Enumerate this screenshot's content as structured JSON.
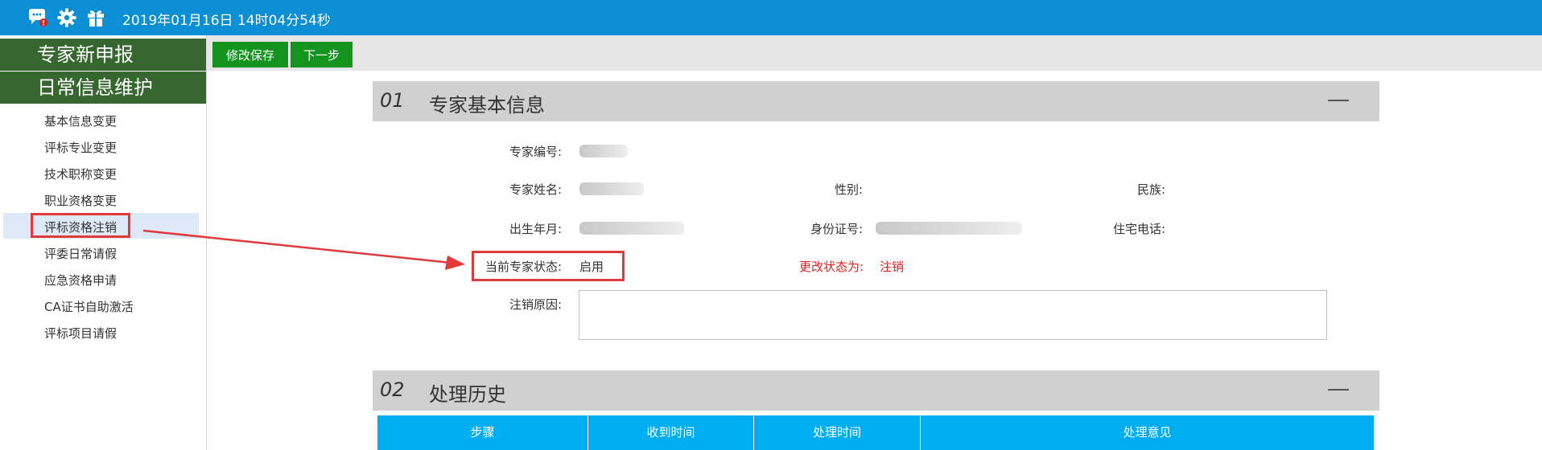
{
  "header": {
    "datetime": "2019年01月16日 14时04分54秒",
    "icons": [
      "chat-bubble-icon",
      "gear-icon",
      "gift-icon"
    ],
    "bg_color": "#0a8fd4"
  },
  "sidebar": {
    "groups": [
      {
        "title": "专家新申报"
      },
      {
        "title": "日常信息维护"
      }
    ],
    "items": [
      {
        "label": "基本信息变更"
      },
      {
        "label": "评标专业变更"
      },
      {
        "label": "技术职称变更"
      },
      {
        "label": "职业资格变更"
      },
      {
        "label": "评标资格注销"
      },
      {
        "label": "评委日常请假"
      },
      {
        "label": "应急资格申请"
      },
      {
        "label": "CA证书自助激活"
      },
      {
        "label": "评标项目请假"
      }
    ],
    "active_index": 4,
    "group_color": "#35672f"
  },
  "toolbar": {
    "save_label": "修改保存",
    "next_label": "下一步",
    "button_color": "#14941e"
  },
  "section1": {
    "number": "01",
    "title": "专家基本信息",
    "collapse_symbol": "—"
  },
  "form": {
    "expert_id_label": "专家编号:",
    "name_label": "专家姓名:",
    "gender_label": "性别:",
    "ethnicity_label": "民族:",
    "birth_label": "出生年月:",
    "id_card_label": "身份证号:",
    "home_phone_label": "住宅电话:",
    "current_status_label": "当前专家状态:",
    "current_status_value": "启用",
    "change_status_label": "更改状态为:",
    "change_status_value": "注销",
    "cancel_reason_label": "注销原因:",
    "cancel_reason_value": ""
  },
  "section2": {
    "number": "02",
    "title": "处理历史",
    "collapse_symbol": "—"
  },
  "history_table": {
    "columns": [
      "步骤",
      "收到时间",
      "处理时间",
      "处理意见"
    ],
    "header_color": "#00adf0"
  },
  "annotation": {
    "color": "#e03a3a"
  }
}
